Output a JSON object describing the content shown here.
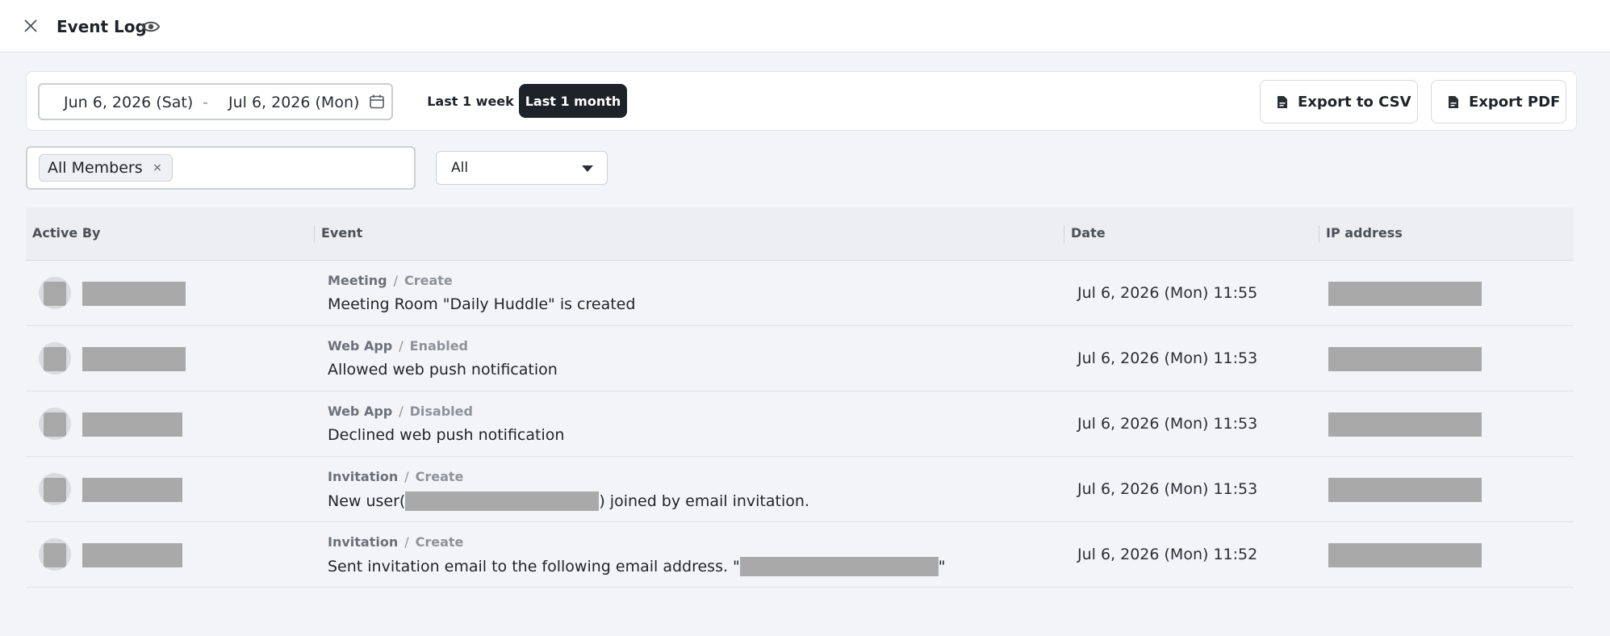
{
  "header": {
    "title": "Event Log",
    "close_icon": "close-icon",
    "visibility_icon": "eye-icon"
  },
  "filters": {
    "date_start": "Jun 6, 2026 (Sat)",
    "date_separator": "-",
    "date_end": "Jul 6, 2026 (Mon)",
    "ranges": [
      "Last 1 week",
      "Last 1 month"
    ],
    "active_range": "Last 1 month",
    "export_csv": "Export to CSV",
    "export_pdf": "Export PDF",
    "member_chip": "All Members",
    "chip_remove": "×",
    "type_select": "All"
  },
  "table": {
    "columns": [
      "Active By",
      "Event",
      "Date",
      "IP address"
    ],
    "rows": [
      {
        "category": "Meeting",
        "action": "Create",
        "description": "Meeting Room \"Daily Huddle\" is created",
        "date": "Jul 6, 2026 (Mon) 11:55"
      },
      {
        "category": "Web App",
        "action": "Enabled",
        "description": "Allowed web push notification",
        "date": "Jul 6, 2026 (Mon) 11:53"
      },
      {
        "category": "Web App",
        "action": "Disabled",
        "description": "Declined web push notification",
        "date": "Jul 6, 2026 (Mon) 11:53"
      },
      {
        "category": "Invitation",
        "action": "Create",
        "description_prefix": "New user(",
        "description_suffix": ") joined by email invitation.",
        "date": "Jul 6, 2026 (Mon) 11:53"
      },
      {
        "category": "Invitation",
        "action": "Create",
        "description_prefix": "Sent invitation email to the following email address. \"",
        "description_suffix": "\"",
        "date": "Jul 6, 2026 (Mon) 11:52"
      }
    ]
  },
  "colors": {
    "accent_dark": "#1e2229",
    "redaction": "#a9a9a9",
    "background": "#f3f4f8"
  }
}
